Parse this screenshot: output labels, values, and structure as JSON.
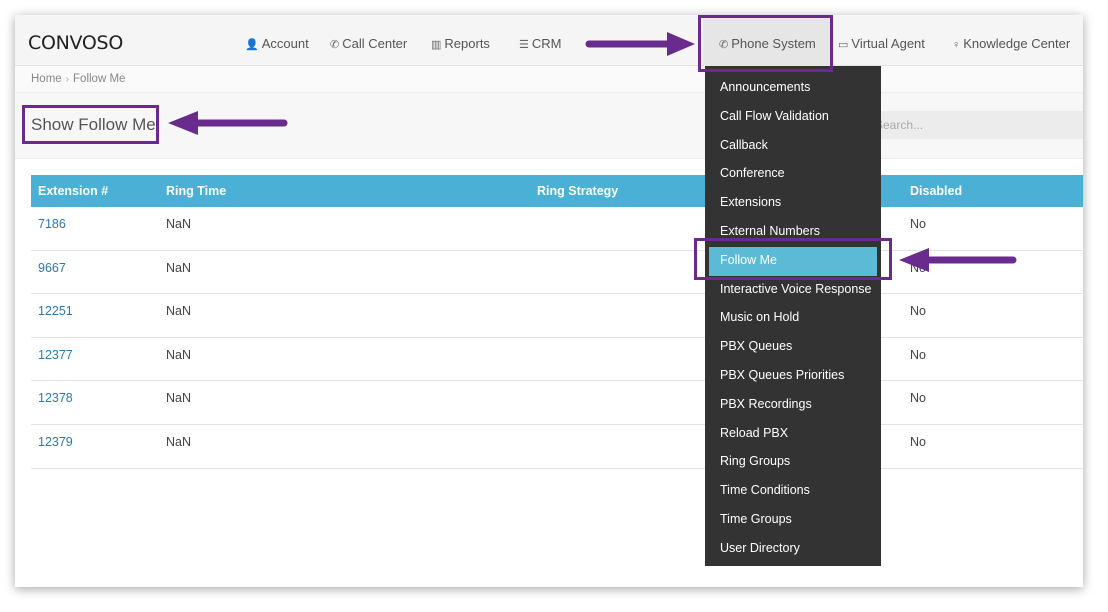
{
  "app": {
    "logo": "CONVOSO"
  },
  "nav": {
    "items": [
      {
        "icon": "👤",
        "label": "Account"
      },
      {
        "icon": "✆",
        "label": "Call Center"
      },
      {
        "icon": "▥",
        "label": "Reports"
      },
      {
        "icon": "☰",
        "label": "CRM"
      },
      {
        "icon": "✆",
        "label": "Phone System"
      },
      {
        "icon": "▭",
        "label": "Virtual Agent"
      },
      {
        "icon": "♀",
        "label": "Knowledge Center"
      }
    ]
  },
  "breadcrumb": {
    "home": "Home",
    "current": "Follow Me",
    "sep": "›"
  },
  "page": {
    "title": "Show Follow Me",
    "search_placeholder": "Search..."
  },
  "table": {
    "headers": {
      "extension": "Extension #",
      "ring_time": "Ring Time",
      "ring_strategy": "Ring Strategy",
      "disabled": "Disabled"
    },
    "rows": [
      {
        "extension": "7186",
        "ring_time": "NaN",
        "disabled": "No"
      },
      {
        "extension": "9667",
        "ring_time": "NaN",
        "disabled": "No"
      },
      {
        "extension": "12251",
        "ring_time": "NaN",
        "disabled": "No"
      },
      {
        "extension": "12377",
        "ring_time": "NaN",
        "disabled": "No"
      },
      {
        "extension": "12378",
        "ring_time": "NaN",
        "disabled": "No"
      },
      {
        "extension": "12379",
        "ring_time": "NaN",
        "disabled": "No"
      }
    ]
  },
  "dropdown": {
    "items": [
      "Announcements",
      "Call Flow Validation",
      "Callback",
      "Conference",
      "Extensions",
      "External Numbers",
      "Follow Me",
      "Interactive Voice Response",
      "Music on Hold",
      "PBX Queues",
      "PBX Queues Priorities",
      "PBX Recordings",
      "Reload PBX",
      "Ring Groups",
      "Time Conditions",
      "Time Groups",
      "User Directory"
    ],
    "active": "Follow Me"
  },
  "colors": {
    "accent": "#4ab0d5",
    "annotation": "#6a2b8e",
    "dropdown_bg": "#333333",
    "link": "#2a7ab0"
  }
}
